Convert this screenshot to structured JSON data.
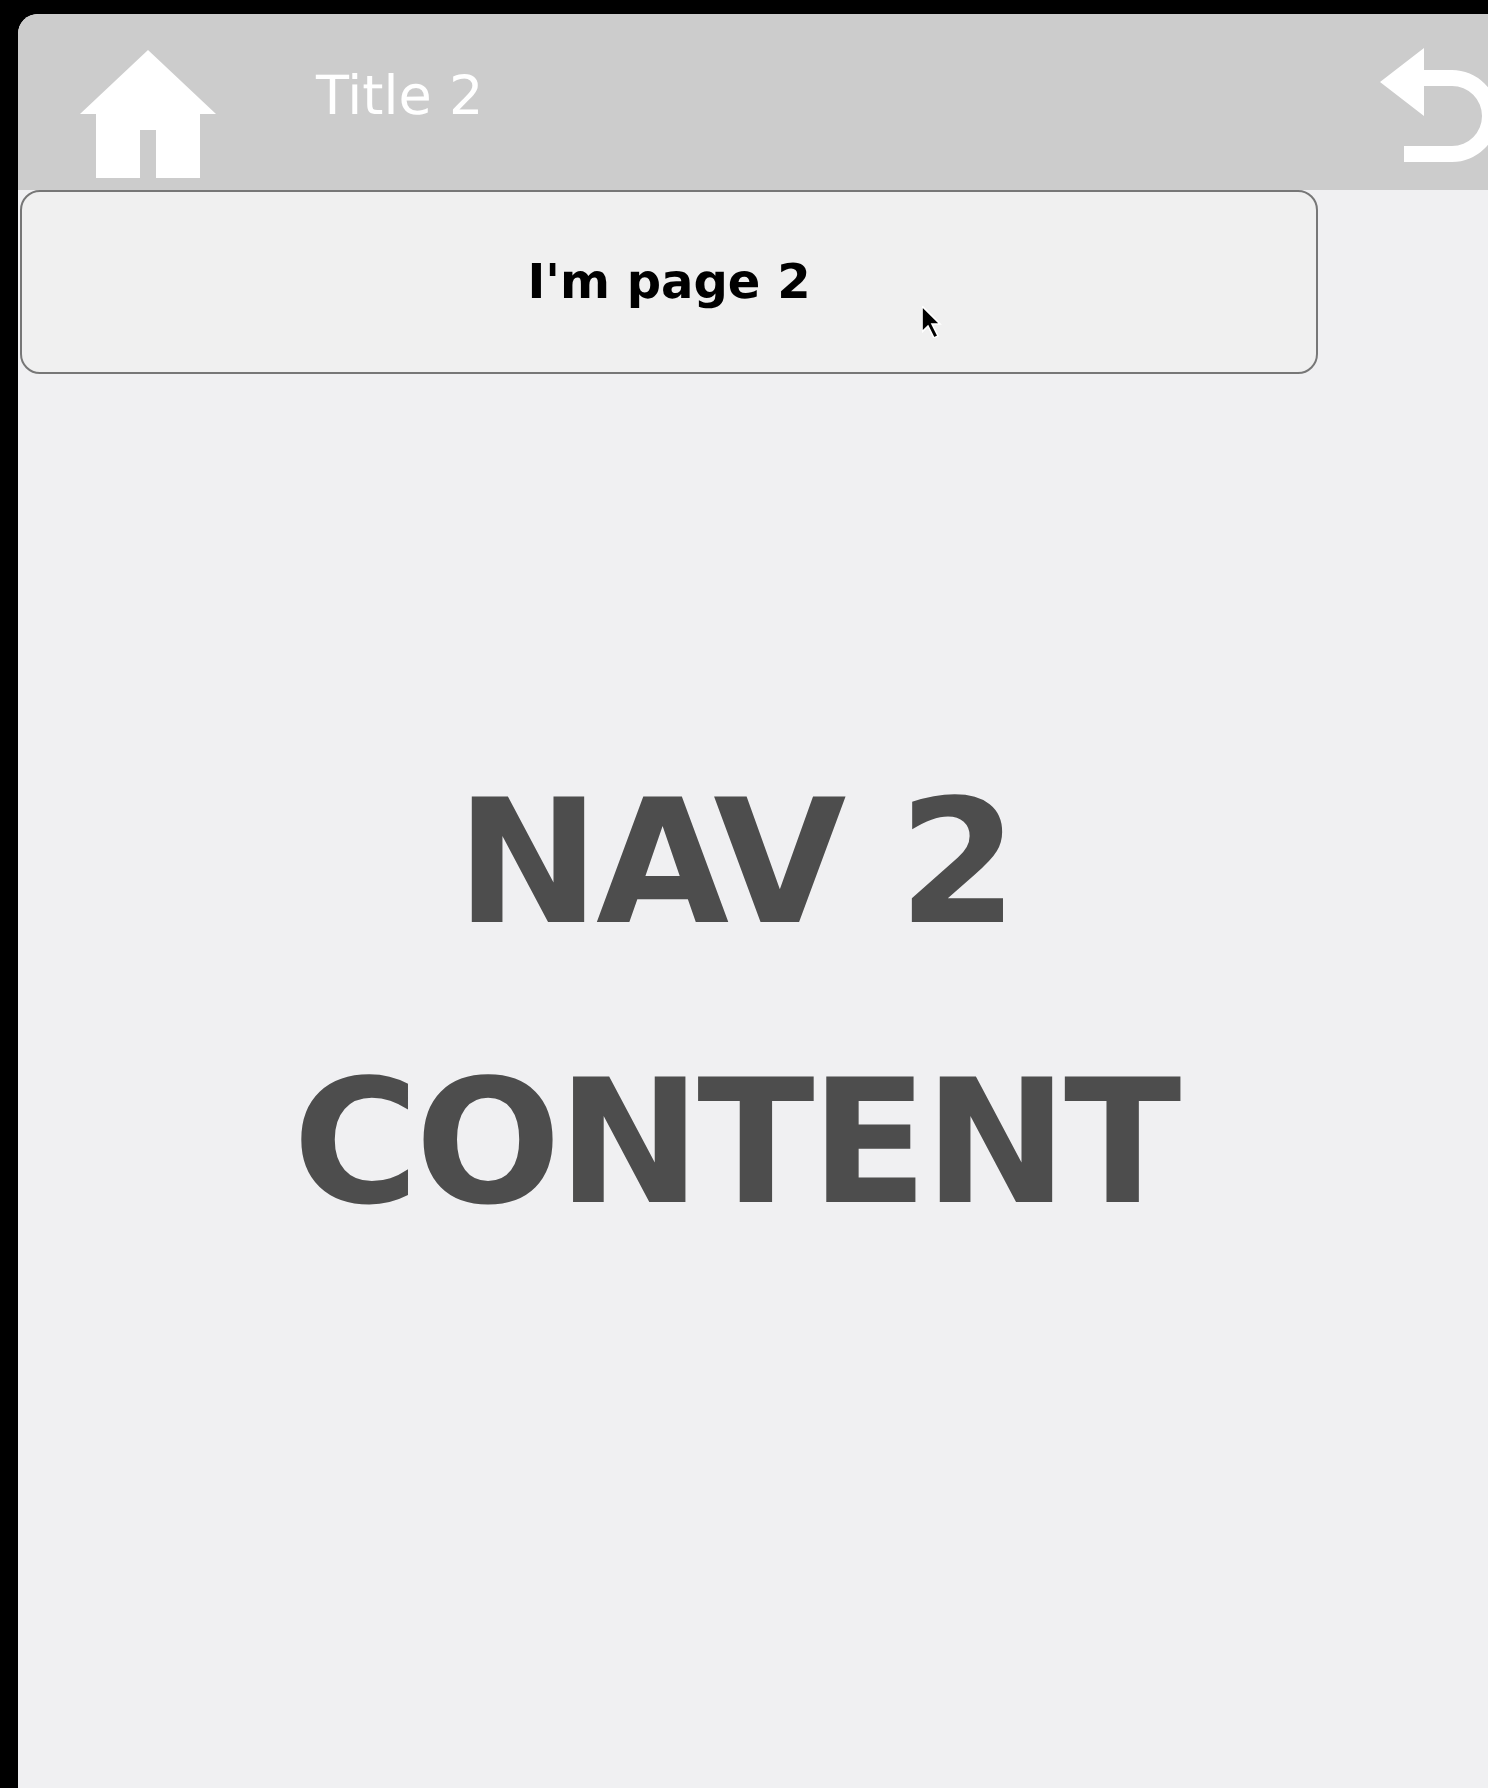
{
  "header": {
    "title": "Title 2"
  },
  "page_button": {
    "label": "I'm page 2"
  },
  "content": {
    "lines": [
      "NAV 2",
      "CONTENT"
    ]
  }
}
